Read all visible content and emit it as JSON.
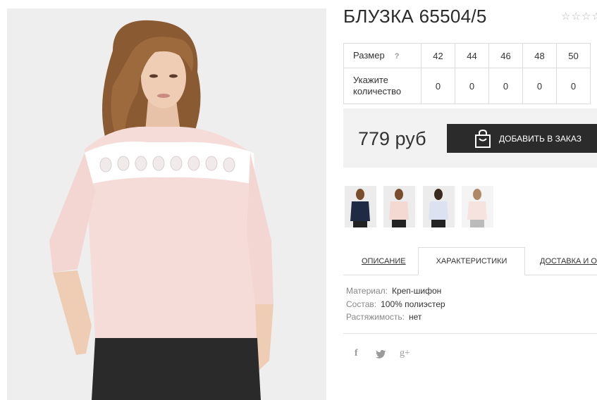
{
  "product": {
    "title": "БЛУЗКА 65504/5",
    "rating_stars": "☆☆☆☆"
  },
  "sizes": {
    "size_label": "Размер",
    "help_mark": "?",
    "qty_label": "Укажите количество",
    "sizes": [
      "42",
      "44",
      "46",
      "48",
      "50"
    ],
    "quantities": [
      "0",
      "0",
      "0",
      "0",
      "0"
    ]
  },
  "purchase": {
    "price": "779 руб",
    "add_button_label": "ДОБАВИТЬ В ЗАКАЗ",
    "button_icon": "shopping-bag-icon"
  },
  "thumbnails": [
    {
      "color": "#1f2a44"
    },
    {
      "color": "#f4d9d3"
    },
    {
      "color": "#dde2f2"
    },
    {
      "color": "#f6e3df"
    }
  ],
  "tabs": [
    {
      "label": "ОПИСАНИЕ"
    },
    {
      "label": "ХАРАКТЕРИСТИКИ"
    },
    {
      "label": "ДОСТАВКА И ОП"
    }
  ],
  "specs": [
    {
      "key": "Материал:",
      "value": "Креп-шифон"
    },
    {
      "key": "Состав:",
      "value": "100% полиэстер"
    },
    {
      "key": "Растяжимость:",
      "value": "нет"
    }
  ],
  "social": {
    "facebook": "f",
    "twitter_icon": "twitter-bird-icon",
    "google_plus": "g+"
  },
  "colors": {
    "blouse": "#f6dcd8",
    "button_bg": "#2b2b2b",
    "price_bg": "#f2f2f2"
  }
}
